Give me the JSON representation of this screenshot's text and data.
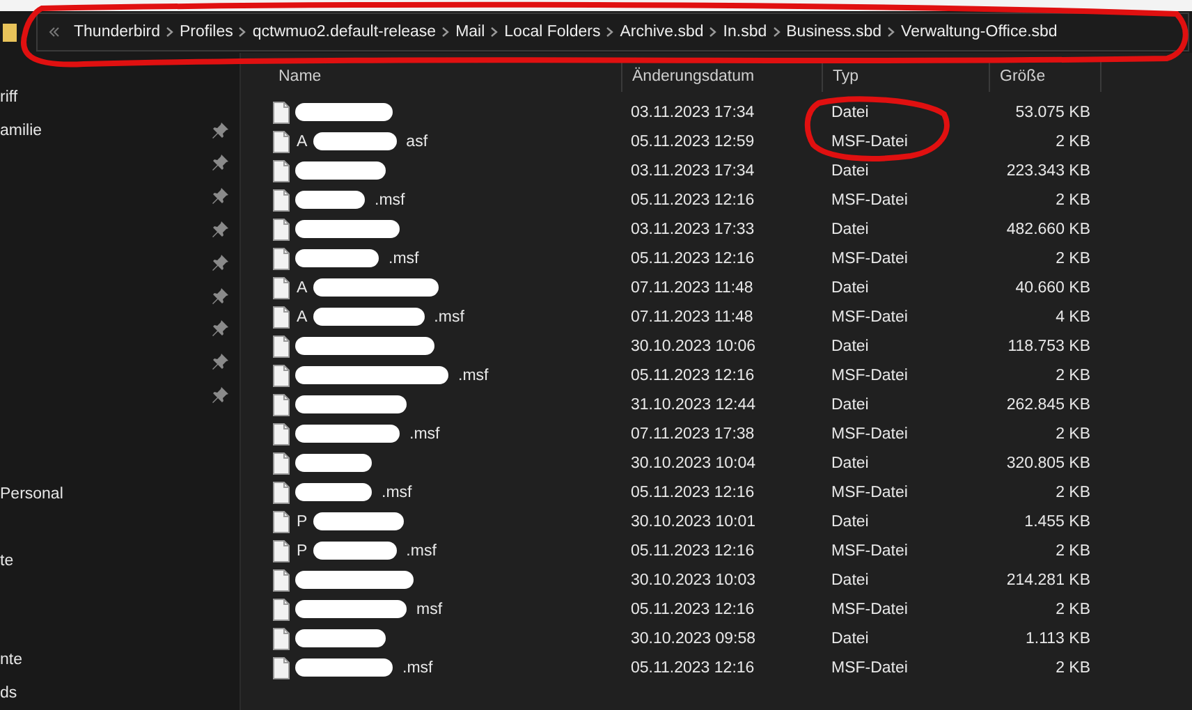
{
  "address_bar": {
    "crumbs": [
      "Thunderbird",
      "Profiles",
      "qctwmuo2.default-release",
      "Mail",
      "Local Folders",
      "Archive.sbd",
      "In.sbd",
      "Business.sbd",
      "Verwaltung-Office.sbd"
    ]
  },
  "sidebar": {
    "items": [
      {
        "label": "riff",
        "pinned": false
      },
      {
        "label": "amilie",
        "pinned": true
      },
      {
        "pinned": true
      },
      {
        "pinned": true
      },
      {
        "pinned": true
      },
      {
        "pinned": true
      },
      {
        "pinned": true
      },
      {
        "pinned": true
      },
      {
        "pinned": true
      },
      {
        "pinned": true
      },
      {
        "pinned": false
      },
      {
        "pinned": false
      },
      {
        "label": "Personal",
        "pinned": false
      },
      {
        "pinned": false
      },
      {
        "label": "te",
        "pinned": false
      },
      {
        "pinned": false
      },
      {
        "pinned": false
      },
      {
        "label": "nte",
        "pinned": false
      },
      {
        "label": "ds",
        "pinned": false
      }
    ]
  },
  "table": {
    "columns": [
      "Name",
      "Änderungsdatum",
      "Typ",
      "Größe"
    ],
    "rows": [
      {
        "date": "03.11.2023 17:34",
        "type": "Datei",
        "size": "53.075 KB"
      },
      {
        "prefix": "A",
        "suffix": "asf",
        "date": "05.11.2023 12:59",
        "type": "MSF-Datei",
        "size": "2 KB"
      },
      {
        "date": "03.11.2023 17:34",
        "type": "Datei",
        "size": "223.343 KB"
      },
      {
        "suffix": ".msf",
        "date": "05.11.2023 12:16",
        "type": "MSF-Datei",
        "size": "2 KB"
      },
      {
        "date": "03.11.2023 17:33",
        "type": "Datei",
        "size": "482.660 KB"
      },
      {
        "suffix": ".msf",
        "date": "05.11.2023 12:16",
        "type": "MSF-Datei",
        "size": "2 KB"
      },
      {
        "prefix": "A",
        "date": "07.11.2023 11:48",
        "type": "Datei",
        "size": "40.660 KB"
      },
      {
        "prefix": "A",
        "suffix": ".msf",
        "date": "07.11.2023 11:48",
        "type": "MSF-Datei",
        "size": "4 KB"
      },
      {
        "date": "30.10.2023 10:06",
        "type": "Datei",
        "size": "118.753 KB"
      },
      {
        "suffix": ".msf",
        "date": "05.11.2023 12:16",
        "type": "MSF-Datei",
        "size": "2 KB"
      },
      {
        "date": "31.10.2023 12:44",
        "type": "Datei",
        "size": "262.845 KB"
      },
      {
        "suffix": ".msf",
        "date": "07.11.2023 17:38",
        "type": "MSF-Datei",
        "size": "2 KB"
      },
      {
        "date": "30.10.2023 10:04",
        "type": "Datei",
        "size": "320.805 KB"
      },
      {
        "suffix": ".msf",
        "date": "05.11.2023 12:16",
        "type": "MSF-Datei",
        "size": "2 KB"
      },
      {
        "prefix": "P",
        "date": "30.10.2023 10:01",
        "type": "Datei",
        "size": "1.455 KB"
      },
      {
        "prefix": "P",
        "suffix": ".msf",
        "date": "05.11.2023 12:16",
        "type": "MSF-Datei",
        "size": "2 KB"
      },
      {
        "date": "30.10.2023 10:03",
        "type": "Datei",
        "size": "214.281 KB"
      },
      {
        "suffix": "msf",
        "date": "05.11.2023 12:16",
        "type": "MSF-Datei",
        "size": "2 KB"
      },
      {
        "date": "30.10.2023 09:58",
        "type": "Datei",
        "size": "1.113 KB"
      },
      {
        "suffix": ".msf",
        "date": "05.11.2023 12:16",
        "type": "MSF-Datei",
        "size": "2 KB"
      }
    ]
  }
}
